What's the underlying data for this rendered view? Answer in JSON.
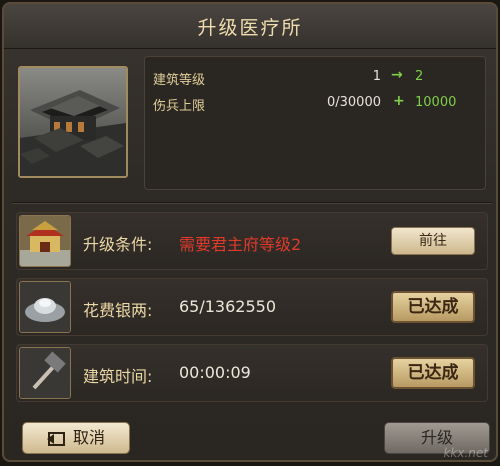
{
  "title": "升级医疗所",
  "stats": [
    {
      "label": "建筑等级",
      "current": "1",
      "new": "2"
    },
    {
      "label": "伤兵上限",
      "current": "0/30000",
      "new": "10000"
    }
  ],
  "stat_separators": {
    "arrow": "→",
    "plus": "+"
  },
  "requirements": [
    {
      "label": "升级条件:",
      "value": "需要君主府等级2",
      "button": "前往"
    },
    {
      "label": "花费银两:",
      "value": "65/1362550",
      "button": "已达成"
    },
    {
      "label": "建筑时间:",
      "value": "00:00:09",
      "button": "已达成"
    }
  ],
  "footer": {
    "cancel_label": "取消",
    "upgrade_label": "升级"
  },
  "watermark": "kkx.net"
}
